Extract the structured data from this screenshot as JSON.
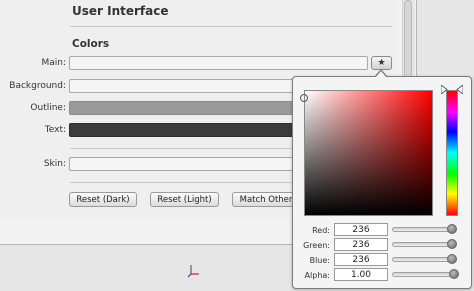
{
  "header": {
    "title": "User Interface"
  },
  "colors_section": {
    "title": "Colors",
    "rows": [
      {
        "label": "Main:",
        "value": "",
        "fill": "#f5f5f5"
      },
      {
        "label": "Background:",
        "value": "",
        "fill": "#f5f5f5"
      },
      {
        "label": "Outline:",
        "value": "",
        "fill": "#9a9a9a"
      },
      {
        "label": "Text:",
        "value": "",
        "fill": "#3b3b3b"
      }
    ],
    "skin_label": "Skin:",
    "buttons": {
      "reset_dark": "Reset (Dark)",
      "reset_light": "Reset (Light)",
      "match_other": "Match Other"
    },
    "picker_button_glyph": "★"
  },
  "color_picker": {
    "hue_color": "#ff0000",
    "channels": [
      {
        "label": "Red:",
        "value": "236",
        "level": 0.93
      },
      {
        "label": "Green:",
        "value": "236",
        "level": 0.93
      },
      {
        "label": "Blue:",
        "value": "236",
        "level": 0.93
      },
      {
        "label": "Alpha:",
        "value": "1.00",
        "level": 1.0
      }
    ]
  },
  "icons": [
    "star-icon",
    "axis-gizmo-icon"
  ]
}
